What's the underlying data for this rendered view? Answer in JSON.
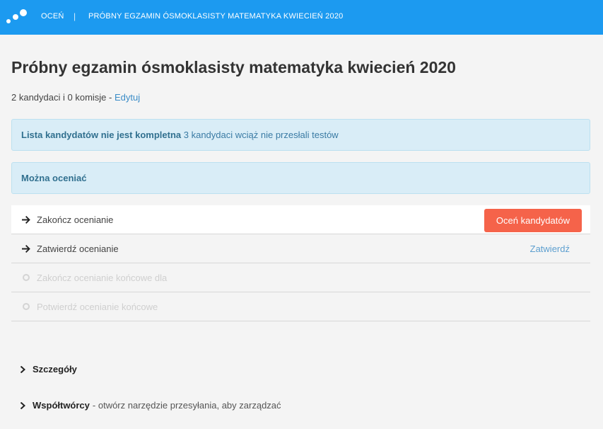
{
  "header": {
    "nav_home": "OCEŃ",
    "separator": "|",
    "nav_exam": "PRÓBNY EGZAMIN ÓSMOKLASISTY MATEMATYKA KWIECIEŃ 2020"
  },
  "page": {
    "title": "Próbny egzamin ósmoklasisty matematyka kwiecień 2020",
    "summary": "2 kandydaci i 0 komisje - ",
    "edit_link": "Edytuj"
  },
  "alerts": [
    {
      "bold": "Lista kandydatów nie jest kompletna",
      "text": "3 kandydaci wciąż nie przesłali testów"
    },
    {
      "bold": "Można oceniać",
      "text": ""
    }
  ],
  "steps": [
    {
      "label": "Zakończ ocenianie",
      "action": "Oceń kandydatów"
    },
    {
      "label": "Zatwierdź ocenianie",
      "action": "Zatwierdź"
    },
    {
      "label": "Zakończ ocenianie końcowe dla"
    },
    {
      "label": "Potwierdź ocenianie końcowe"
    }
  ],
  "sections": {
    "details": "Szczegóły",
    "collaborators": "Współtwórcy",
    "collaborators_hint": "- otwórz narzędzie przesyłania, aby zarządzać"
  },
  "colors": {
    "topbar": "#1c9af0",
    "primary_button": "#f5634a",
    "alert_bg": "#d9edf7",
    "link": "#3a8cc7"
  }
}
